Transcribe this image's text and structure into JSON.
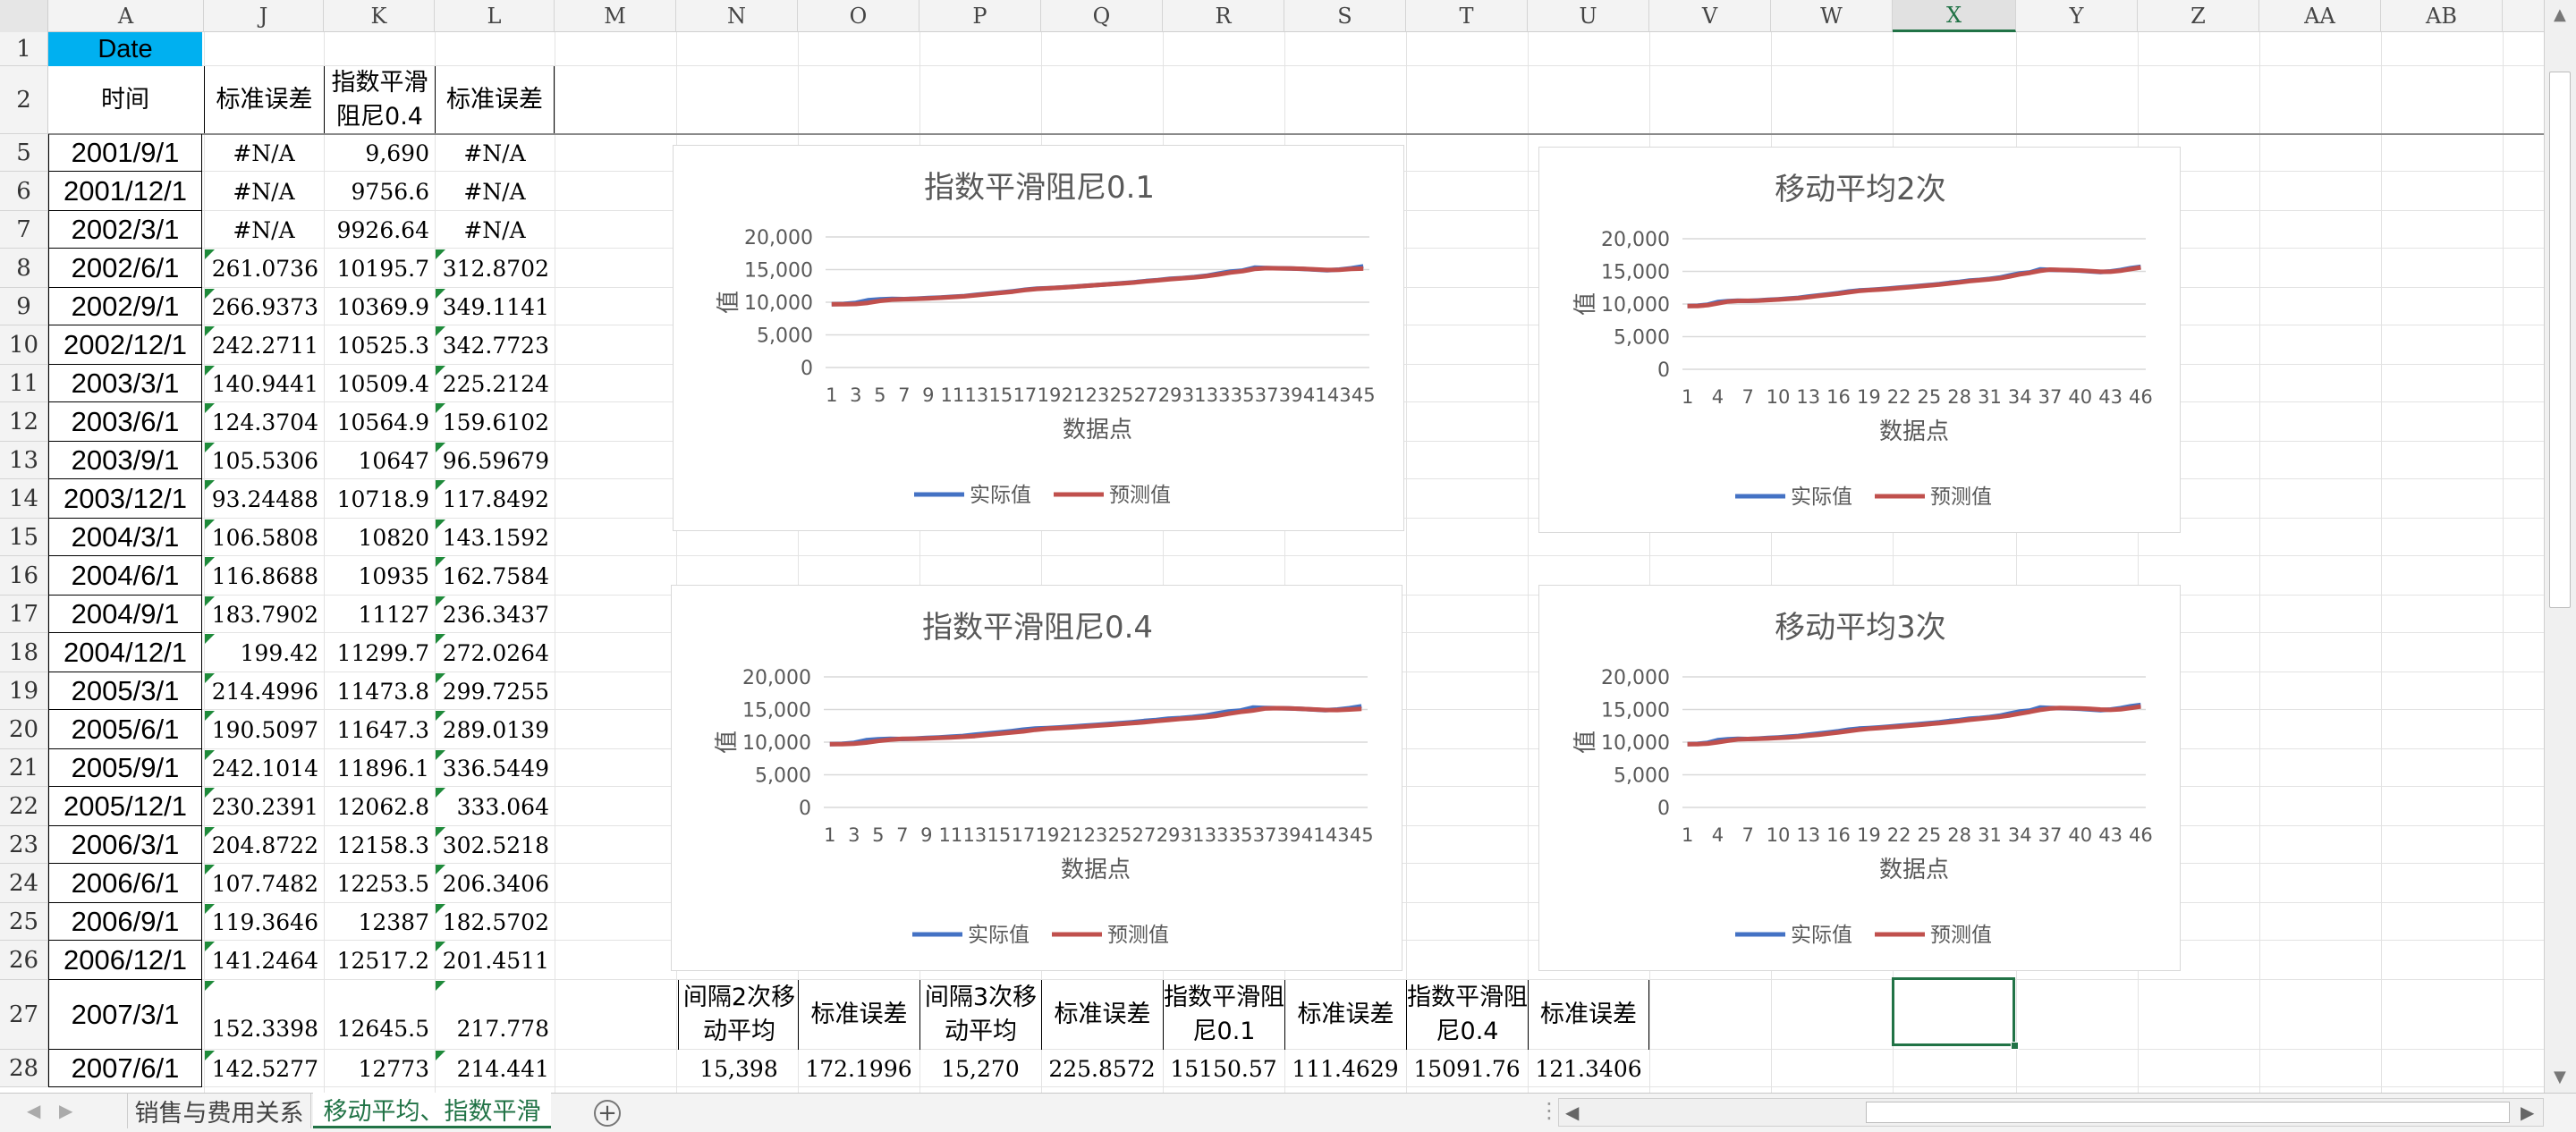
{
  "columns": [
    "A",
    "J",
    "K",
    "L",
    "M",
    "N",
    "O",
    "P",
    "Q",
    "R",
    "S",
    "T",
    "U",
    "V",
    "W",
    "X",
    "Y",
    "Z",
    "AA",
    "AB"
  ],
  "selected_column": "X",
  "row_numbers": [
    "1",
    "2",
    "5",
    "6",
    "7",
    "8",
    "9",
    "10",
    "11",
    "12",
    "13",
    "14",
    "15",
    "16",
    "17",
    "18",
    "19",
    "20",
    "21",
    "22",
    "23",
    "24",
    "25",
    "26",
    "27",
    "28"
  ],
  "header_row1": {
    "date_label": "Date"
  },
  "header_row2": {
    "time_label": "时间",
    "j": "标准误差",
    "k": "指数平滑阻尼0.4",
    "l": "标准误差"
  },
  "rows": [
    {
      "date": "2001/9/1",
      "j": "#N/A",
      "k": "9,690",
      "l": "#N/A"
    },
    {
      "date": "2001/12/1",
      "j": "#N/A",
      "k": "9756.6",
      "l": "#N/A"
    },
    {
      "date": "2002/3/1",
      "j": "#N/A",
      "k": "9926.64",
      "l": "#N/A"
    },
    {
      "date": "2002/6/1",
      "j": "261.0736",
      "k": "10195.7",
      "l": "312.8702"
    },
    {
      "date": "2002/9/1",
      "j": "266.9373",
      "k": "10369.9",
      "l": "349.1141"
    },
    {
      "date": "2002/12/1",
      "j": "242.2711",
      "k": "10525.3",
      "l": "342.7723"
    },
    {
      "date": "2003/3/1",
      "j": "140.9441",
      "k": "10509.4",
      "l": "225.2124"
    },
    {
      "date": "2003/6/1",
      "j": "124.3704",
      "k": "10564.9",
      "l": "159.6102"
    },
    {
      "date": "2003/9/1",
      "j": "105.5306",
      "k": "10647",
      "l": "96.59679"
    },
    {
      "date": "2003/12/1",
      "j": "93.24488",
      "k": "10718.9",
      "l": "117.8492"
    },
    {
      "date": "2004/3/1",
      "j": "106.5808",
      "k": "10820",
      "l": "143.1592"
    },
    {
      "date": "2004/6/1",
      "j": "116.8688",
      "k": "10935",
      "l": "162.7584"
    },
    {
      "date": "2004/9/1",
      "j": "183.7902",
      "k": "11127",
      "l": "236.3437"
    },
    {
      "date": "2004/12/1",
      "j": "199.42",
      "k": "11299.7",
      "l": "272.0264"
    },
    {
      "date": "2005/3/1",
      "j": "214.4996",
      "k": "11473.8",
      "l": "299.7255"
    },
    {
      "date": "2005/6/1",
      "j": "190.5097",
      "k": "11647.3",
      "l": "289.0139"
    },
    {
      "date": "2005/9/1",
      "j": "242.1014",
      "k": "11896.1",
      "l": "336.5449"
    },
    {
      "date": "2005/12/1",
      "j": "230.2391",
      "k": "12062.8",
      "l": "333.064"
    },
    {
      "date": "2006/3/1",
      "j": "204.8722",
      "k": "12158.3",
      "l": "302.5218"
    },
    {
      "date": "2006/6/1",
      "j": "107.7482",
      "k": "12253.5",
      "l": "206.3406"
    },
    {
      "date": "2006/9/1",
      "j": "119.3646",
      "k": "12387",
      "l": "182.5702"
    },
    {
      "date": "2006/12/1",
      "j": "141.2464",
      "k": "12517.2",
      "l": "201.4511"
    },
    {
      "date": "2007/3/1",
      "j": "152.3398",
      "k": "12645.5",
      "l": "217.778"
    },
    {
      "date": "2007/6/1",
      "j": "142.5277",
      "k": "12773",
      "l": "214.441"
    }
  ],
  "summary_headers": [
    "间隔2次移动平均",
    "标准误差",
    "间隔3次移动平均",
    "标准误差",
    "指数平滑阻尼0.1",
    "标准误差",
    "指数平滑阻尼0.4",
    "标准误差"
  ],
  "summary_values": [
    "15,398",
    "172.1996",
    "15,270",
    "225.8572",
    "15150.57",
    "111.4629",
    "15091.76",
    "121.3406"
  ],
  "sheet_tabs": {
    "tab1": "销售与费用关系",
    "tab2": "移动平均、指数平滑",
    "add_icon": "plus-circle-icon"
  },
  "colors": {
    "actual": "#4472c4",
    "forecast": "#c0504d",
    "accent": "#217346",
    "header_cell": "#00b0f0"
  },
  "chart_data": [
    {
      "type": "line",
      "title": "指数平滑阻尼0.1",
      "xlabel": "数据点",
      "ylabel": "值",
      "ylim": [
        0,
        20000
      ],
      "yticks": [
        "0",
        "5,000",
        "10,000",
        "15,000",
        "20,000"
      ],
      "xticks": [
        "1",
        "3",
        "5",
        "7",
        "9",
        "11",
        "13",
        "15",
        "17",
        "19",
        "21",
        "23",
        "25",
        "27",
        "29",
        "31",
        "33",
        "35",
        "37",
        "39",
        "41",
        "43",
        "45"
      ],
      "legend": [
        "实际值",
        "预测值"
      ],
      "series": [
        {
          "name": "实际值",
          "values": [
            9690,
            9740,
            9900,
            10300,
            10450,
            10500,
            10480,
            10550,
            10640,
            10720,
            10830,
            10950,
            11150,
            11320,
            11500,
            11680,
            11920,
            12080,
            12170,
            12260,
            12390,
            12520,
            12650,
            12780,
            12900,
            13050,
            13250,
            13400,
            13600,
            13700,
            13850,
            14050,
            14400,
            14700,
            14850,
            15300,
            15250,
            15200,
            15180,
            15100,
            15000,
            14900,
            15000,
            15200,
            15500
          ]
        },
        {
          "name": "预测值",
          "values": [
            9690,
            9690,
            9720,
            9900,
            10200,
            10400,
            10470,
            10500,
            10580,
            10680,
            10780,
            10900,
            11080,
            11260,
            11440,
            11620,
            11860,
            12040,
            12140,
            12240,
            12370,
            12500,
            12630,
            12760,
            12880,
            13020,
            13200,
            13360,
            13540,
            13660,
            13800,
            13980,
            14250,
            14550,
            14750,
            15100,
            15220,
            15190,
            15170,
            15120,
            15040,
            14950,
            14970,
            15100,
            15150
          ]
        }
      ]
    },
    {
      "type": "line",
      "title": "移动平均2次",
      "xlabel": "数据点",
      "ylabel": "值",
      "ylim": [
        0,
        20000
      ],
      "yticks": [
        "0",
        "5,000",
        "10,000",
        "15,000",
        "20,000"
      ],
      "xticks": [
        "1",
        "4",
        "7",
        "10",
        "13",
        "16",
        "19",
        "22",
        "25",
        "28",
        "31",
        "34",
        "37",
        "40",
        "43",
        "46"
      ],
      "legend": [
        "实际值",
        "预测值"
      ],
      "series": [
        {
          "name": "实际值",
          "values": [
            9690,
            9740,
            9900,
            10300,
            10450,
            10500,
            10480,
            10550,
            10640,
            10720,
            10830,
            10950,
            11150,
            11320,
            11500,
            11680,
            11920,
            12080,
            12170,
            12260,
            12390,
            12520,
            12650,
            12780,
            12900,
            13050,
            13250,
            13400,
            13600,
            13700,
            13850,
            14050,
            14400,
            14700,
            14850,
            15300,
            15250,
            15200,
            15180,
            15100,
            15000,
            14900,
            15000,
            15200,
            15500,
            15700
          ]
        },
        {
          "name": "预测值",
          "values": [
            9690,
            9700,
            9820,
            10100,
            10380,
            10480,
            10490,
            10520,
            10600,
            10680,
            10780,
            10890,
            11050,
            11240,
            11410,
            11590,
            11800,
            12000,
            12120,
            12210,
            12320,
            12450,
            12580,
            12710,
            12840,
            12970,
            13150,
            13320,
            13500,
            13650,
            13780,
            13950,
            14220,
            14550,
            14780,
            15080,
            15270,
            15220,
            15190,
            15140,
            15050,
            14950,
            14950,
            15100,
            15350,
            15600
          ]
        }
      ]
    },
    {
      "type": "line",
      "title": "指数平滑阻尼0.4",
      "xlabel": "数据点",
      "ylabel": "值",
      "ylim": [
        0,
        20000
      ],
      "yticks": [
        "0",
        "5,000",
        "10,000",
        "15,000",
        "20,000"
      ],
      "xticks": [
        "1",
        "3",
        "5",
        "7",
        "9",
        "11",
        "13",
        "15",
        "17",
        "19",
        "21",
        "23",
        "25",
        "27",
        "29",
        "31",
        "33",
        "35",
        "37",
        "39",
        "41",
        "43",
        "45"
      ],
      "legend": [
        "实际值",
        "预测值"
      ],
      "series": [
        {
          "name": "实际值",
          "values": [
            9690,
            9740,
            9900,
            10300,
            10450,
            10500,
            10480,
            10550,
            10640,
            10720,
            10830,
            10950,
            11150,
            11320,
            11500,
            11680,
            11920,
            12080,
            12170,
            12260,
            12390,
            12520,
            12650,
            12780,
            12900,
            13050,
            13250,
            13400,
            13600,
            13700,
            13850,
            14050,
            14400,
            14700,
            14850,
            15300,
            15250,
            15200,
            15180,
            15100,
            15000,
            14900,
            15000,
            15200,
            15500
          ]
        },
        {
          "name": "预测值",
          "values": [
            9690,
            9690,
            9757,
            9927,
            10196,
            10370,
            10525,
            10509,
            10565,
            10647,
            10719,
            10820,
            10935,
            11127,
            11300,
            11474,
            11647,
            11896,
            12063,
            12158,
            12254,
            12387,
            12517,
            12646,
            12773,
            12900,
            13050,
            13230,
            13380,
            13560,
            13690,
            13830,
            14030,
            14350,
            14650,
            14830,
            15150,
            15200,
            15170,
            15100,
            15020,
            14930,
            14920,
            15000,
            15100
          ]
        }
      ]
    },
    {
      "type": "line",
      "title": "移动平均3次",
      "xlabel": "数据点",
      "ylabel": "值",
      "ylim": [
        0,
        20000
      ],
      "yticks": [
        "0",
        "5,000",
        "10,000",
        "15,000",
        "20,000"
      ],
      "xticks": [
        "1",
        "4",
        "7",
        "10",
        "13",
        "16",
        "19",
        "22",
        "25",
        "28",
        "31",
        "34",
        "37",
        "40",
        "43",
        "46"
      ],
      "legend": [
        "实际值",
        "预测值"
      ],
      "series": [
        {
          "name": "实际值",
          "values": [
            9690,
            9740,
            9900,
            10300,
            10450,
            10500,
            10480,
            10550,
            10640,
            10720,
            10830,
            10950,
            11150,
            11320,
            11500,
            11680,
            11920,
            12080,
            12170,
            12260,
            12390,
            12520,
            12650,
            12780,
            12900,
            13050,
            13250,
            13400,
            13600,
            13700,
            13850,
            14050,
            14400,
            14700,
            14850,
            15300,
            15250,
            15200,
            15180,
            15100,
            15000,
            14900,
            15000,
            15200,
            15500,
            15700
          ]
        },
        {
          "name": "预测值",
          "values": [
            9690,
            9700,
            9780,
            9980,
            10220,
            10420,
            10480,
            10510,
            10560,
            10640,
            10730,
            10830,
            10980,
            11140,
            11320,
            11500,
            11700,
            11900,
            12060,
            12170,
            12270,
            12390,
            12520,
            12650,
            12780,
            12910,
            13070,
            13230,
            13420,
            13570,
            13720,
            13870,
            14100,
            14380,
            14650,
            14950,
            15150,
            15250,
            15210,
            15160,
            15090,
            15000,
            14950,
            15030,
            15230,
            15470
          ]
        }
      ]
    }
  ]
}
